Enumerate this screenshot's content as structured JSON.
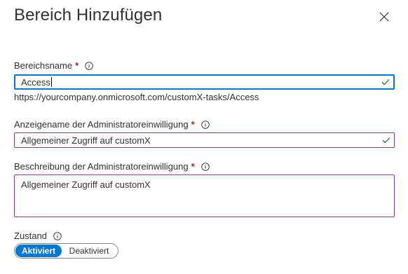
{
  "dialog": {
    "title": "Bereich Hinzufügen"
  },
  "fields": {
    "scope_name": {
      "label": "Bereichsname",
      "required_mark": "*",
      "value": "Access",
      "hint": "https://yourcompany.onmicrosoft.com/customX-tasks/Access"
    },
    "admin_display_name": {
      "label": "Anzeigename der Administratoreinwilligung",
      "required_mark": "*",
      "value": "Allgemeiner Zugriff auf customX"
    },
    "admin_description": {
      "label": "Beschreibung der Administratoreinwilligung",
      "required_mark": "*",
      "value": "Allgemeiner Zugriff auf customX"
    },
    "state": {
      "label": "Zustand",
      "options": [
        "Aktiviert",
        "Deaktiviert"
      ],
      "selected": "Aktiviert"
    }
  },
  "colors": {
    "accent": "#0078d4",
    "field_border": "#8a3a8f",
    "required": "#a4262c",
    "valid_check": "#107c10"
  },
  "icons": {
    "close": "close-icon",
    "info": "info-icon",
    "check": "check-icon"
  }
}
